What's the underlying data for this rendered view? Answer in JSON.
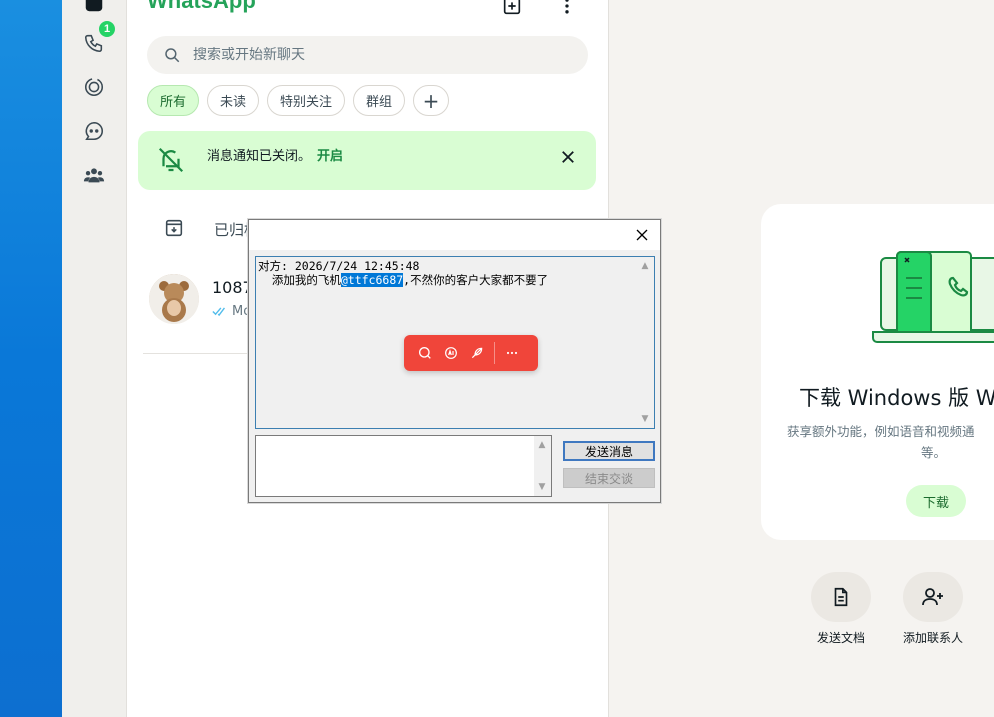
{
  "sidebar": {
    "calls_badge": "1",
    "icons": [
      "chats-icon",
      "phone-icon",
      "status-icon",
      "channels-icon",
      "communities-icon"
    ]
  },
  "header": {
    "title": "WhatsApp"
  },
  "search": {
    "placeholder": "搜索或开始新聊天"
  },
  "filters": [
    {
      "label": "所有",
      "active": true
    },
    {
      "label": "未读",
      "active": false
    },
    {
      "label": "特别关注",
      "active": false
    },
    {
      "label": "群组",
      "active": false
    }
  ],
  "filters_add": "+",
  "notification_banner": {
    "text": "消息通知已关闭。",
    "link": "开启"
  },
  "archived": {
    "label": "已归档"
  },
  "chat": {
    "name": "1087",
    "preview": "Mo"
  },
  "download_card": {
    "title": "下载 Windows 版 W",
    "description": "获享额外功能，例如语音和视频通",
    "description_tail": "等。",
    "button": "下载"
  },
  "actions": [
    {
      "label": "发送文档",
      "icon": "document-icon"
    },
    {
      "label": "添加联系人",
      "icon": "add-contact-icon"
    }
  ],
  "dialog": {
    "log_line1": "对方: 2026/7/24 12:45:48",
    "log_line2_prefix": "  添加我的飞机",
    "log_line2_highlight": "@ttfc6687",
    "log_line2_suffix": ",不然你的客户大家都不要了",
    "send_button": "发送消息",
    "end_button": "结束交谈"
  },
  "colors": {
    "brand_green": "#25a35a",
    "banner_bg": "#d9fdd3",
    "toolbar_red": "#f0453a",
    "highlight": "#0078d7"
  }
}
